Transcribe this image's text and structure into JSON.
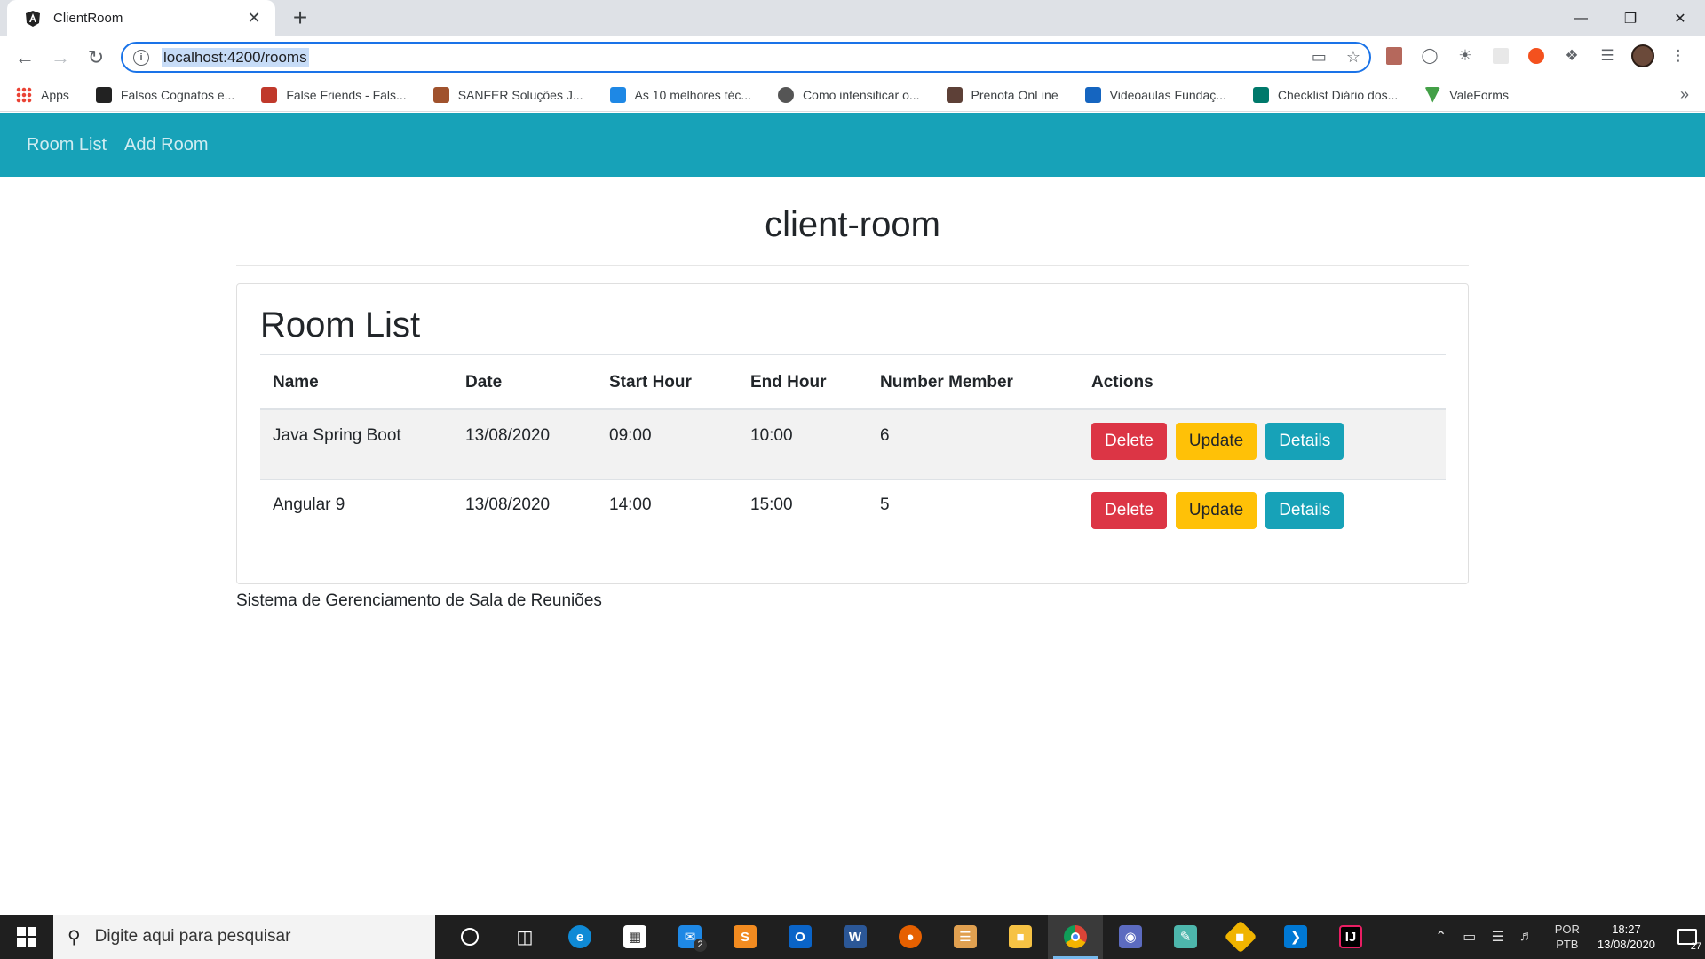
{
  "browser": {
    "tab_title": "ClientRoom",
    "tab_close": "✕",
    "new_tab": "+",
    "url": "localhost:4200/rooms",
    "bookmarks": [
      {
        "label": "Apps",
        "color": "#ea4335"
      },
      {
        "label": "Falsos Cognatos e...",
        "color": "#222222"
      },
      {
        "label": "False Friends - Fals...",
        "color": "#c0392b"
      },
      {
        "label": "SANFER Soluções J...",
        "color": "#a0522d"
      },
      {
        "label": "As 10 melhores téc...",
        "color": "#1e88e5"
      },
      {
        "label": "Como intensificar o...",
        "color": "#555555"
      },
      {
        "label": "Prenota OnLine",
        "color": "#5d4037"
      },
      {
        "label": "Videoaulas Fundaç...",
        "color": "#1565c0"
      },
      {
        "label": "Checklist Diário dos...",
        "color": "#00796b"
      },
      {
        "label": "ValeForms",
        "color": "#43a047"
      }
    ],
    "bookmarks_more": "»"
  },
  "navbar": {
    "links": [
      "Room List",
      "Add Room"
    ],
    "color": "#17a2b8"
  },
  "page": {
    "app_title": "client-room",
    "card_title": "Room List",
    "footer": "Sistema de Gerenciamento de Sala de Reuniões"
  },
  "table": {
    "headers": [
      "Name",
      "Date",
      "Start Hour",
      "End Hour",
      "Number Member",
      "Actions"
    ],
    "rows": [
      {
        "name": "Java Spring Boot",
        "date": "13/08/2020",
        "start": "09:00",
        "end": "10:00",
        "members": "6"
      },
      {
        "name": "Angular 9",
        "date": "13/08/2020",
        "start": "14:00",
        "end": "15:00",
        "members": "5"
      }
    ],
    "actions": {
      "delete": "Delete",
      "update": "Update",
      "details": "Details"
    }
  },
  "taskbar": {
    "search_placeholder": "Digite aqui para pesquisar",
    "lang_top": "POR",
    "lang_bottom": "PTB",
    "time": "18:27",
    "date": "13/08/2020",
    "notifications": "27",
    "mail_badge": "2"
  }
}
